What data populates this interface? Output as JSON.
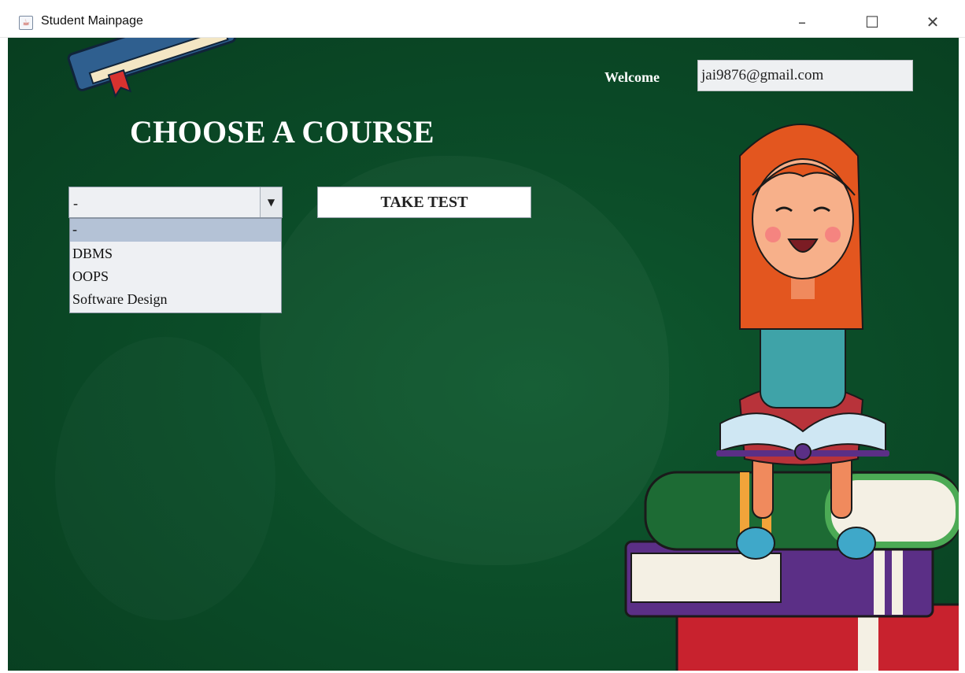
{
  "window": {
    "title": "Student Mainpage",
    "icon": "java-app-icon",
    "controls": {
      "minimize": "–",
      "maximize": "☐",
      "close": "✕"
    }
  },
  "header": {
    "welcome_label": "Welcome",
    "email_value": "jai9876@gmail.com"
  },
  "main": {
    "title": "CHOOSE A COURSE",
    "course_select": {
      "selected": "-",
      "options": [
        "-",
        "DBMS",
        "OOPS",
        "Software Design"
      ]
    },
    "take_test_label": "TAKE TEST"
  },
  "colors": {
    "background": "#0b4c28",
    "selected_option": "#b4c2d6",
    "text_light": "#ffffff"
  }
}
